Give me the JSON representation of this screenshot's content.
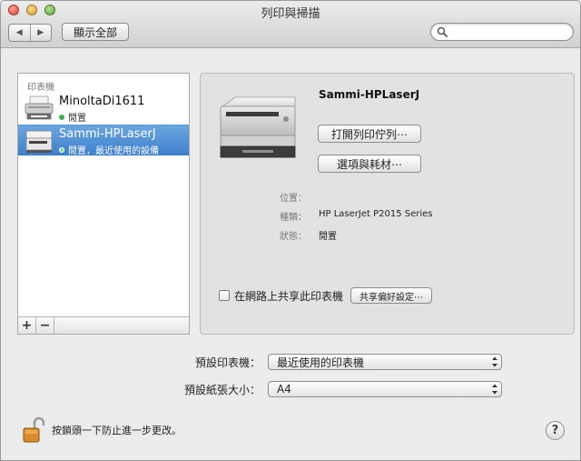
{
  "window": {
    "title": "列印與掃描"
  },
  "toolbar": {
    "back_icon": "chevron-left-icon",
    "forward_icon": "chevron-right-icon",
    "show_all_label": "顯示全部",
    "search_placeholder": "",
    "search_value": ""
  },
  "printer_list": {
    "header": "印表機",
    "items": [
      {
        "name": "MinoltaDi1611",
        "status": "閒置",
        "selected": false,
        "status_color": "#39b54a"
      },
      {
        "name": "Sammi-HPLaserJ",
        "status": "閒置，最近使用的設備",
        "selected": true,
        "status_color": "#39b54a"
      }
    ],
    "add_label": "+",
    "remove_label": "−"
  },
  "detail": {
    "printer_name": "Sammi-HPLaserJ",
    "open_queue_label": "打開列印佇列⋯",
    "options_supplies_label": "選項與耗材⋯",
    "location_label": "位置：",
    "location_value": "",
    "kind_label": "種類：",
    "kind_value": "HP LaserJet P2015 Series",
    "status_label": "狀態：",
    "status_value": "閒置",
    "share_checkbox_label": "在網路上共享此印表機",
    "share_checked": false,
    "sharing_prefs_label": "共享偏好設定⋯"
  },
  "defaults": {
    "default_printer_label": "預設印表機：",
    "default_printer_value": "最近使用的印表機",
    "default_paper_label": "預設紙張大小：",
    "default_paper_value": "A4"
  },
  "footer": {
    "lock_text": "按鎖頭一下防止進一步更改。",
    "help_label": "?"
  },
  "colors": {
    "selection": "#3e7fcb",
    "status_idle": "#39b54a"
  }
}
